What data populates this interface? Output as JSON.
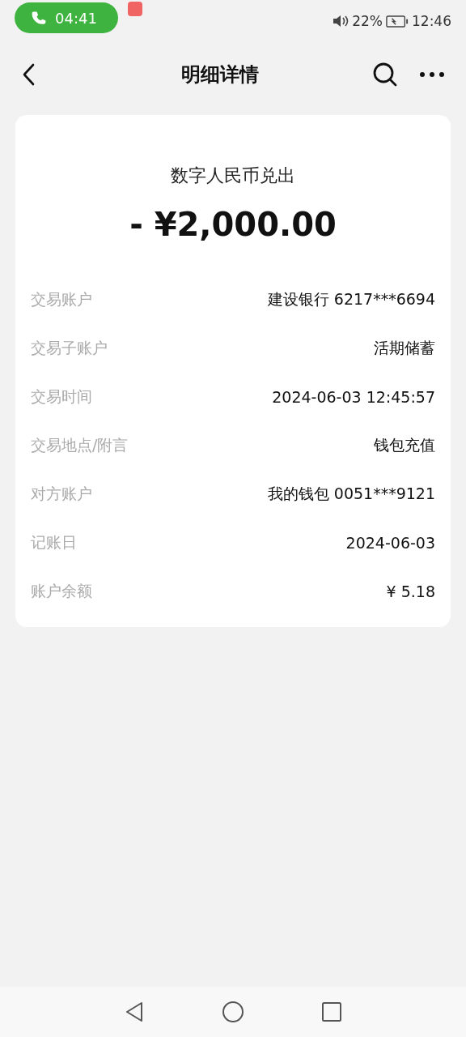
{
  "status_bar": {
    "call_time": "04:41",
    "battery": "22%",
    "time": "12:46"
  },
  "header": {
    "title": "明细详情"
  },
  "detail": {
    "type": "数字人民币兑出",
    "amount": "- ¥2,000.00",
    "rows": [
      {
        "label": "交易账户",
        "value": "建设银行 6217***6694"
      },
      {
        "label": "交易子账户",
        "value": "活期储蓄"
      },
      {
        "label": "交易时间",
        "value": "2024-06-03 12:45:57"
      },
      {
        "label": "交易地点/附言",
        "value": "钱包充值"
      },
      {
        "label": "对方账户",
        "value": "我的钱包 0051***9121"
      },
      {
        "label": "记账日",
        "value": "2024-06-03"
      },
      {
        "label": "账户余额",
        "value": "¥ 5.18"
      }
    ]
  }
}
